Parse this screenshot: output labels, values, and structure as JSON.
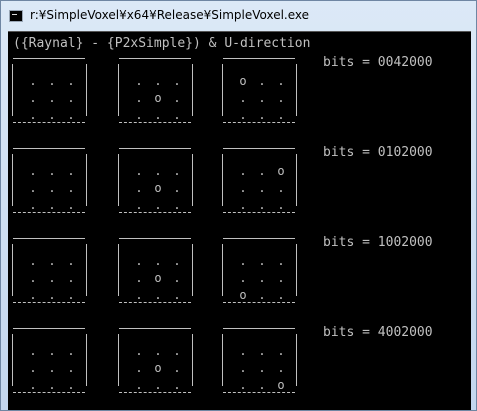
{
  "window": {
    "title": "r:¥SimpleVoxel¥x64¥Release¥SimpleVoxel.exe"
  },
  "console": {
    "header": "({Raynal} - {P2xSimple}) & U-direction",
    "dot": ".",
    "voxel": "o",
    "groups": [
      {
        "bits_label": "bits = 0042000",
        "cubes": [
          {
            "marks": [
              ".",
              ".",
              ".",
              ".",
              ".",
              ".",
              ".",
              ".",
              "."
            ]
          },
          {
            "marks": [
              ".",
              ".",
              ".",
              ".",
              "o",
              ".",
              ".",
              ".",
              "."
            ]
          },
          {
            "marks": [
              "o",
              ".",
              ".",
              ".",
              ".",
              ".",
              ".",
              ".",
              "."
            ]
          }
        ]
      },
      {
        "bits_label": "bits = 0102000",
        "cubes": [
          {
            "marks": [
              ".",
              ".",
              ".",
              ".",
              ".",
              ".",
              ".",
              ".",
              "."
            ]
          },
          {
            "marks": [
              ".",
              ".",
              ".",
              ".",
              "o",
              ".",
              ".",
              ".",
              "."
            ]
          },
          {
            "marks": [
              ".",
              ".",
              "o",
              ".",
              ".",
              ".",
              ".",
              ".",
              "."
            ]
          }
        ]
      },
      {
        "bits_label": "bits = 1002000",
        "cubes": [
          {
            "marks": [
              ".",
              ".",
              ".",
              ".",
              ".",
              ".",
              ".",
              ".",
              "."
            ]
          },
          {
            "marks": [
              ".",
              ".",
              ".",
              ".",
              "o",
              ".",
              ".",
              ".",
              "."
            ]
          },
          {
            "marks": [
              ".",
              ".",
              ".",
              ".",
              ".",
              ".",
              "o",
              ".",
              "."
            ]
          }
        ]
      },
      {
        "bits_label": "bits = 4002000",
        "cubes": [
          {
            "marks": [
              ".",
              ".",
              ".",
              ".",
              ".",
              ".",
              ".",
              ".",
              "."
            ]
          },
          {
            "marks": [
              ".",
              ".",
              ".",
              ".",
              "o",
              ".",
              ".",
              ".",
              "."
            ]
          },
          {
            "marks": [
              ".",
              ".",
              ".",
              ".",
              ".",
              ".",
              ".",
              ".",
              "o"
            ]
          }
        ]
      }
    ]
  },
  "colors": {
    "console_background": "#000000",
    "console_text": "#c0c0c0"
  }
}
